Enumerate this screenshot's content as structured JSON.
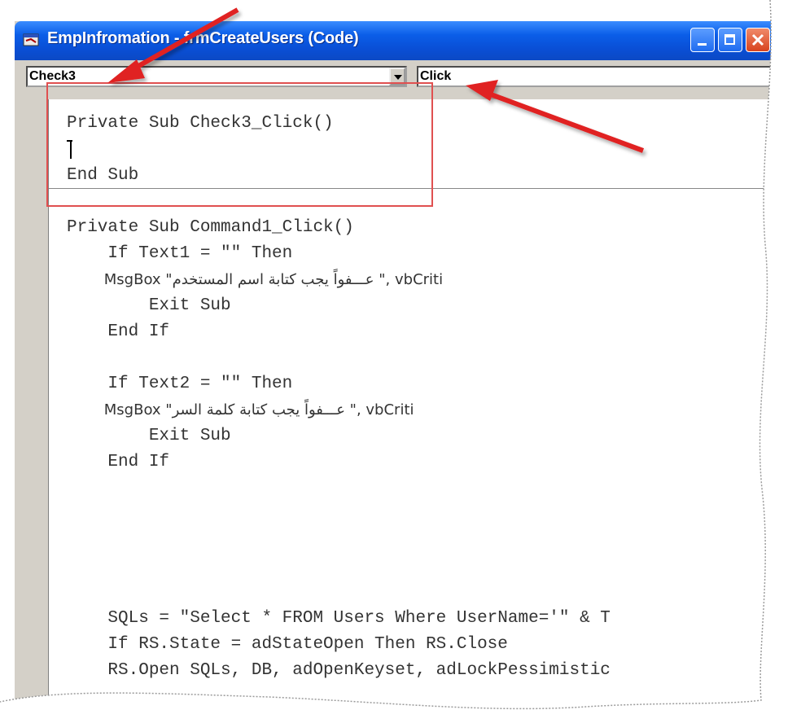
{
  "window": {
    "title": "EmpInfromation - frmCreateUsers (Code)"
  },
  "object_combo": {
    "selected": "Check3"
  },
  "procedure_combo": {
    "selected": "Click"
  },
  "code": {
    "lines": [
      "Private Sub Check3_Click()",
      "",
      "End Sub",
      "",
      "Private Sub Command1_Click()",
      "    If Text1 = \"\" Then",
      "        MsgBox \"عـــفواً يجب كتابة اسم المستخدم \", vbCriti",
      "        Exit Sub",
      "    End If",
      "",
      "    If Text2 = \"\" Then",
      "        MsgBox \"عـــفواً يجب كتابة كلمة السر \", vbCriti",
      "        Exit Sub",
      "    End If",
      "",
      "",
      "",
      "",
      "",
      "    SQLs = \"Select * FROM Users Where UserName='\" & T",
      "    If RS.State = adStateOpen Then RS.Close",
      "    RS.Open SQLs, DB, adOpenKeyset, adLockPessimistic"
    ]
  },
  "colors": {
    "titlebar": "#0b5ee8",
    "annotation": "#e02020",
    "chrome": "#d4d0c8"
  },
  "icons": [
    "window-icon",
    "minimize-icon",
    "maximize-icon",
    "close-icon",
    "dropdown-arrow-icon",
    "scroll-up-icon"
  ]
}
